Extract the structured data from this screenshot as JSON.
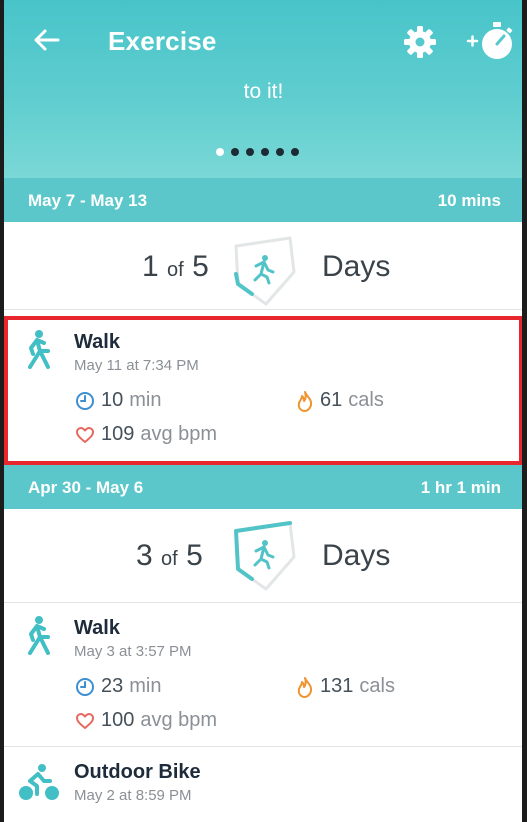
{
  "header": {
    "title": "Exercise",
    "tagline": "to it!",
    "dots": [
      true,
      false,
      false,
      false,
      false,
      false
    ],
    "colors": {
      "header_top": "#48c4c9",
      "header_bottom": "#7ad8d6",
      "accent": "#5cc7ca"
    }
  },
  "weeks": [
    {
      "range": "May 7 - May 13",
      "total": "10 mins",
      "count": "1",
      "of": "of",
      "goal": "5",
      "days_label": "Days",
      "progress": 0.2,
      "activities": [
        {
          "name": "Walk",
          "when": "May 11 at 7:34 PM",
          "icon": "walk-icon",
          "duration_value": "10",
          "duration_unit": "min",
          "calories_value": "61",
          "calories_unit": "cals",
          "bpm_value": "109",
          "bpm_unit": "avg bpm"
        }
      ]
    },
    {
      "range": "Apr 30 - May 6",
      "total": "1 hr 1 min",
      "count": "3",
      "of": "of",
      "goal": "5",
      "days_label": "Days",
      "progress": 0.6,
      "activities": [
        {
          "name": "Walk",
          "when": "May 3 at 3:57 PM",
          "icon": "walk-icon",
          "duration_value": "23",
          "duration_unit": "min",
          "calories_value": "131",
          "calories_unit": "cals",
          "bpm_value": "100",
          "bpm_unit": "avg bpm"
        },
        {
          "name": "Outdoor Bike",
          "when": "May 2 at 8:59 PM",
          "icon": "bike-icon"
        }
      ]
    }
  ]
}
